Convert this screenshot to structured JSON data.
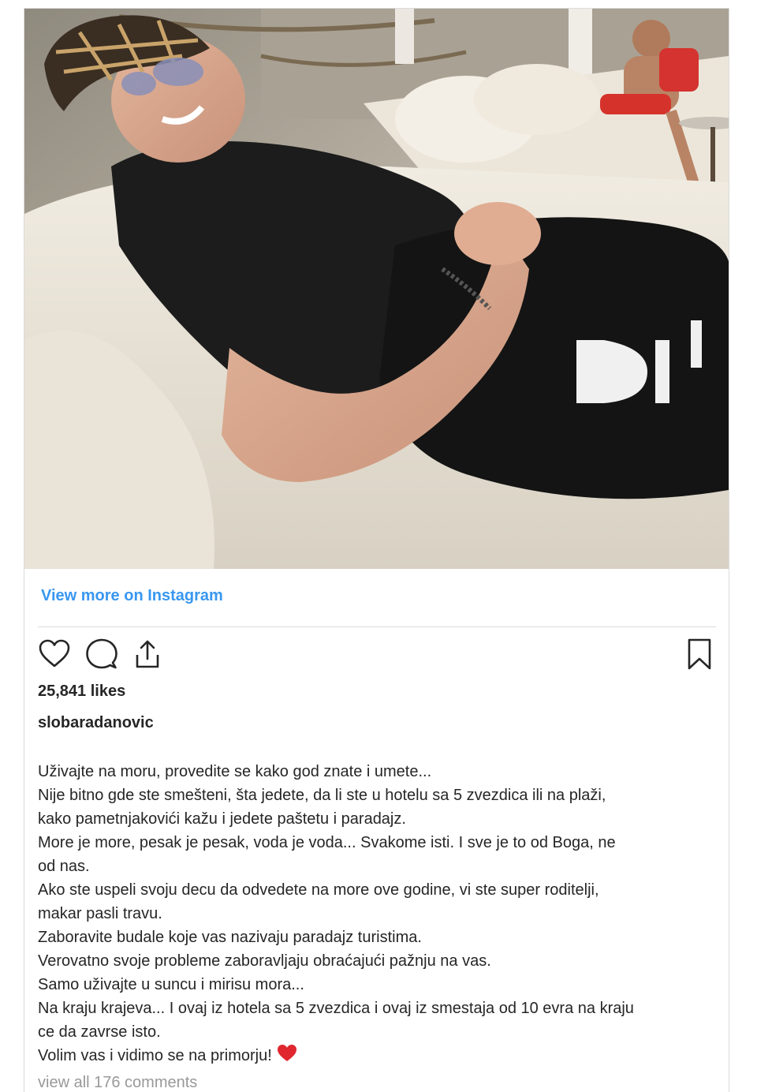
{
  "links": {
    "view_more": "View more on Instagram"
  },
  "actions": {
    "like_icon": "heart-outline-icon",
    "comment_icon": "speech-bubble-icon",
    "share_icon": "share-upload-icon",
    "save_icon": "bookmark-icon"
  },
  "post": {
    "likes": "25,841 likes",
    "username": "slobaradanovic",
    "caption_lines": [
      "Uživajte na moru, provedite se kako god znate i umete...",
      "Nije bitno gde ste smešteni, šta jedete, da li ste u hotelu sa 5 zvezdica ili na plaži,",
      "kako pametnjakovići kažu i jedete paštetu i paradajz.",
      "More je more, pesak je pesak, voda je voda... Svakome isti. I sve je to od Boga, ne",
      "od nas.",
      "Ako ste uspeli svoju decu da odvedete na more ove godine, vi ste super roditelji,",
      "makar pasli travu.",
      "Zaboravite budale koje vas nazivaju paradajz turistima.",
      "Verovatno svoje probleme zaboravljaju obraćajući pažnju na vas.",
      "Samo uživajte u suncu i mirisu mora...",
      "Na kraju krajeva... I ovaj iz hotela sa 5 zvezdica i ovaj iz smestaja od 10 evra na kraju",
      "ce da zavrse isto.",
      "Volim vas i vidimo se na primorju!"
    ],
    "caption_emoji": "red-heart-emoji",
    "comments_link": "view all 176 comments"
  },
  "colors": {
    "link_blue": "#3897f0",
    "text": "#262626",
    "muted": "#999999",
    "border": "#dbdbdb",
    "heart_red": "#e0262f"
  }
}
